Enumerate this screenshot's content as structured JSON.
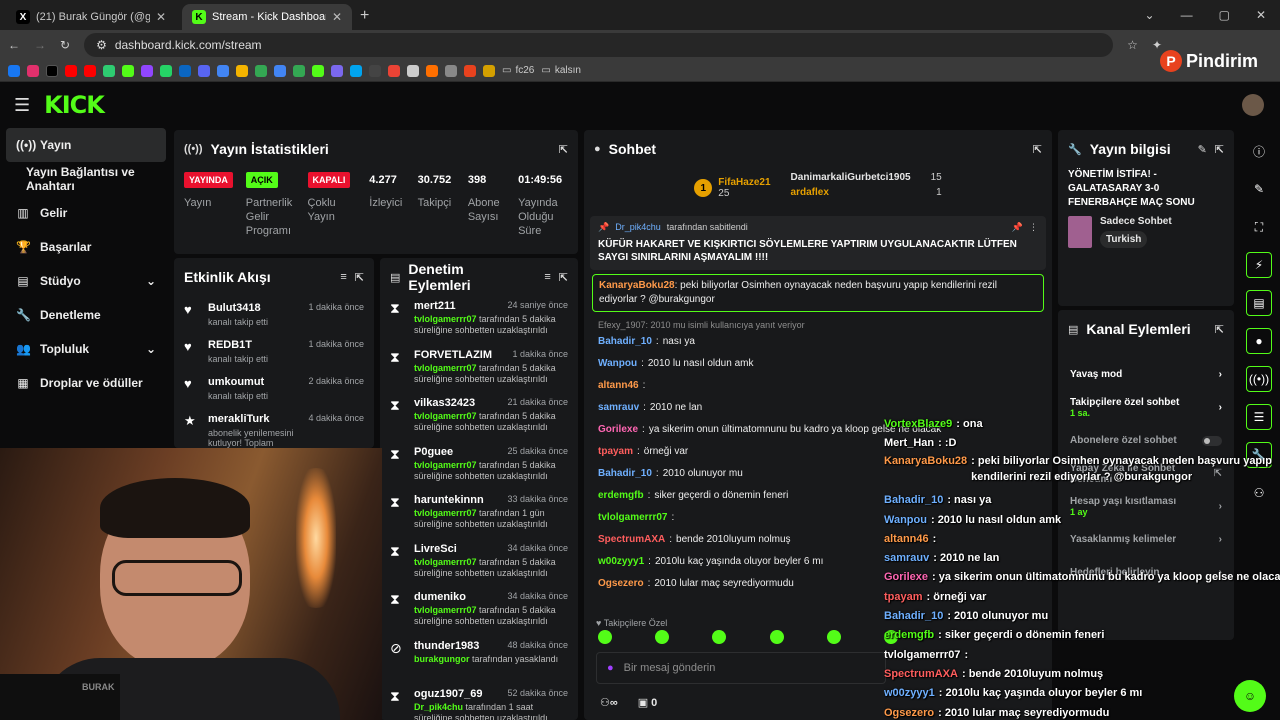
{
  "browser": {
    "tabs": [
      {
        "icon": "X",
        "title": "(21) Burak Güngör (@gungorbu..."
      },
      {
        "icon": "K",
        "title": "Stream - Kick Dashboard"
      }
    ],
    "url": "dashboard.kick.com/stream",
    "bookmarks": [
      "fc26",
      "kalsın"
    ]
  },
  "watermark": "Pindirim",
  "header": {
    "logo": "KICK"
  },
  "nav": {
    "items": [
      {
        "label": "Yayın",
        "icon": "broadcast-icon"
      },
      {
        "label": "Yayın Bağlantısı ve Anahtarı",
        "icon": ""
      },
      {
        "label": "Gelir",
        "icon": "chart-icon"
      },
      {
        "label": "Başarılar",
        "icon": "trophy-icon"
      },
      {
        "label": "Stüdyo",
        "icon": "studio-icon"
      },
      {
        "label": "Denetleme",
        "icon": "wrench-icon"
      },
      {
        "label": "Topluluk",
        "icon": "community-icon"
      },
      {
        "label": "Droplar ve ödüller",
        "icon": "drops-icon"
      }
    ]
  },
  "stats": {
    "title": "Yayın İstatistikleri",
    "badges": [
      {
        "badge": "YAYINDA",
        "label": "Yayın"
      },
      {
        "badge": "AÇIK",
        "label": "Partnerlik Gelir Programı"
      },
      {
        "badge": "KAPALI",
        "label": "Çoklu Yayın"
      }
    ],
    "values": [
      {
        "value": "4.277",
        "label": "İzleyici"
      },
      {
        "value": "30.752",
        "label": "Takipçi"
      },
      {
        "value": "398",
        "label": "Abone Sayısı"
      },
      {
        "value": "01:49:56",
        "label": "Yayında Olduğu Süre"
      }
    ]
  },
  "activity": {
    "title": "Etkinlik Akışı",
    "items": [
      {
        "name": "Bulut3418",
        "desc": "kanalı takip etti",
        "time": "1 dakika önce"
      },
      {
        "name": "REDB1T",
        "desc": "kanalı takip etti",
        "time": "1 dakika önce"
      },
      {
        "name": "umkoumut",
        "desc": "kanalı takip etti",
        "time": "2 dakika önce"
      },
      {
        "name": "merakliTurk",
        "desc": "abonelik yenilemesini kutluyor! Toplam",
        "time": "4 dakika önce"
      }
    ]
  },
  "moderation": {
    "title": "Denetim Eylemleri",
    "items": [
      {
        "name": "mert211",
        "time": "24 saniye önce",
        "by": "tvlolgamerrr07",
        "desc": "tarafından 5 dakika süreliğine sohbetten uzaklaştırıldı"
      },
      {
        "name": "FORVETLAZIM",
        "time": "1 dakika önce",
        "by": "tvlolgamerrr07",
        "desc": "tarafından 5 dakika süreliğine sohbetten uzaklaştırıldı"
      },
      {
        "name": "vilkas32423",
        "time": "21 dakika önce",
        "by": "tvlolgamerrr07",
        "desc": "tarafından 5 dakika süreliğine sohbetten uzaklaştırıldı"
      },
      {
        "name": "P0guee",
        "time": "25 dakika önce",
        "by": "tvlolgamerrr07",
        "desc": "tarafından 5 dakika süreliğine sohbetten uzaklaştırıldı"
      },
      {
        "name": "haruntekinnn",
        "time": "33 dakika önce",
        "by": "tvlolgamerrr07",
        "desc": "tarafından 1 gün süreliğine sohbetten uzaklaştırıldı"
      },
      {
        "name": "LivreSci",
        "time": "34 dakika önce",
        "by": "tvlolgamerrr07",
        "desc": "tarafından 5 dakika süreliğine sohbetten uzaklaştırıldı"
      },
      {
        "name": "dumeniko",
        "time": "34 dakika önce",
        "by": "tvlolgamerrr07",
        "desc": "tarafından 5 dakika süreliğine sohbetten uzaklaştırıldı"
      },
      {
        "name": "thunder1983",
        "time": "48 dakika önce",
        "by": "burakgungor",
        "desc": "tarafından yasaklandı"
      },
      {
        "name": "oguz1907_69",
        "time": "52 dakika önce",
        "by": "Dr_pik4chu",
        "desc": "tarafından 1 saat süreliğine sohbetten uzaklaştırıldı"
      }
    ]
  },
  "chat": {
    "title": "Sohbet",
    "gifters": [
      {
        "name": "FifaHaze21",
        "count": "25"
      },
      {
        "name": "DanimarkaliGurbetci1905",
        "count": "15"
      },
      {
        "name": "ardaflex",
        "count": "1"
      }
    ],
    "pinned_by": "Dr_pik4chu",
    "pinned_suffix": "tarafından sabitlendi",
    "pinned_msg": "KÜFÜR HAKARET VE KIŞKIRTICI SÖYLEMLERE YAPTIRIM UYGULANACAKTIR LÜTFEN SAYGI SINIRLARINI AŞMAYALIM !!!!",
    "highlight_user": "KanaryaBoku28",
    "highlight_msg": "peki biliyorlar Osimhen oynayacak neden başvuru yapıp kendilerini rezil ediyorlar ? @burakgungor",
    "reply_note": "Efexy_1907: 2010 mu isimli kullanıcıya yanıt veriyor",
    "messages": [
      {
        "user": "Bahadir_10",
        "color": "#6fb0ff",
        "text": "nası ya"
      },
      {
        "user": "Wanpou",
        "color": "#6fb0ff",
        "text": "2010 lu nasıl oldun amk"
      },
      {
        "user": "altann46",
        "color": "#ff9a4a",
        "text": ""
      },
      {
        "user": "samrauv",
        "color": "#6fb0ff",
        "text": "2010 ne lan"
      },
      {
        "user": "Gorilexe",
        "color": "#ff66b3",
        "text": "ya sikerim onun ültimatomnunu bu kadro ya kloop gelse ne olacak"
      },
      {
        "user": "tpayam",
        "color": "#ff5e5e",
        "text": "örneği var"
      },
      {
        "user": "Bahadir_10",
        "color": "#6fb0ff",
        "text": "2010 olunuyor mu"
      },
      {
        "user": "erdemgfb",
        "color": "#53fc18",
        "text": "siker geçerdi o dönemin feneri"
      },
      {
        "user": "tvlolgamerrr07",
        "color": "#53fc18",
        "text": ""
      },
      {
        "user": "SpectrumAXA",
        "color": "#ff5e5e",
        "text": "bende 2010luyum nolmuş"
      },
      {
        "user": "w00zyyy1",
        "color": "#53fc18",
        "text": "2010lu kaç yaşında oluyor beyler 6 mı"
      },
      {
        "user": "Ogsezero",
        "color": "#ff9a4a",
        "text": "2010 lular maç seyrediyormudu"
      }
    ],
    "followers_only": "Takipçilere Özel",
    "input_placeholder": "Bir mesaj gönderin",
    "footer_count": "0"
  },
  "info": {
    "title": "Yayın bilgisi",
    "stream_title": "YÖNETİM İSTİFA! - GALATASARAY 3-0 FENERBAHÇE MAÇ SONU",
    "category": "Sadece Sohbet",
    "language": "Turkish"
  },
  "actions": {
    "title": "Kanal Eylemleri",
    "items": [
      {
        "label": "Yavaş mod",
        "sub": ""
      },
      {
        "label": "Takipçilere özel sohbet",
        "sub": "1 sa."
      },
      {
        "label": "Abonelere özel sohbet",
        "sub": ""
      },
      {
        "label": "Yapay Zeka ile Sohbet Denetimi",
        "sub": ""
      },
      {
        "label": "Hesap yaşı kısıtlaması",
        "sub": "1 ay"
      },
      {
        "label": "Yasaklanmış kelimeler",
        "sub": ""
      },
      {
        "label": "Hedefleri belirleyin",
        "sub": ""
      }
    ]
  },
  "overlay": {
    "rows": [
      {
        "user": "VortexBlaze9",
        "color": "#53fc18",
        "text": ": ona"
      },
      {
        "user": "Mert_Han",
        "color": "#ffffff",
        "text": ": :D"
      },
      {
        "user": "KanaryaBoku28",
        "color": "#ff9a4a",
        "text": ": peki biliyorlar Osimhen oynayacak neden başvuru yapıp kendilerini rezil ediyorlar ? @burakgungor"
      },
      {
        "user": "Bahadir_10",
        "color": "#6fb0ff",
        "text": ": nası ya"
      },
      {
        "user": "Wanpou",
        "color": "#6fb0ff",
        "text": ": 2010 lu nasıl oldun amk"
      },
      {
        "user": "altann46",
        "color": "#ff9a4a",
        "text": ":"
      },
      {
        "user": "samrauv",
        "color": "#6fb0ff",
        "text": ": 2010 ne lan"
      },
      {
        "user": "Gorilexe",
        "color": "#ff66b3",
        "text": ": ya sikerim onun ültimatomnunu bu kadro ya kloop gelse ne olacak"
      },
      {
        "user": "tpayam",
        "color": "#ff5e5e",
        "text": ": örneği var"
      },
      {
        "user": "Bahadir_10",
        "color": "#6fb0ff",
        "text": ": 2010 olunuyor mu"
      },
      {
        "user": "erdemgfb",
        "color": "#53fc18",
        "text": ": siker geçerdi o dönemin feneri"
      },
      {
        "user": "tvlolgamerrr07",
        "color": "#ffffff",
        "text": ":"
      },
      {
        "user": "SpectrumAXA",
        "color": "#ff5e5e",
        "text": ": bende 2010luyum nolmuş"
      },
      {
        "user": "w00zyyy1",
        "color": "#6fb0ff",
        "text": ": 2010lu kaç yaşında oluyor beyler 6 mı"
      },
      {
        "user": "Ogsezero",
        "color": "#ff9a4a",
        "text": ": 2010 lular maç seyrediyormudu"
      }
    ]
  },
  "webcam_label": "BURAK"
}
